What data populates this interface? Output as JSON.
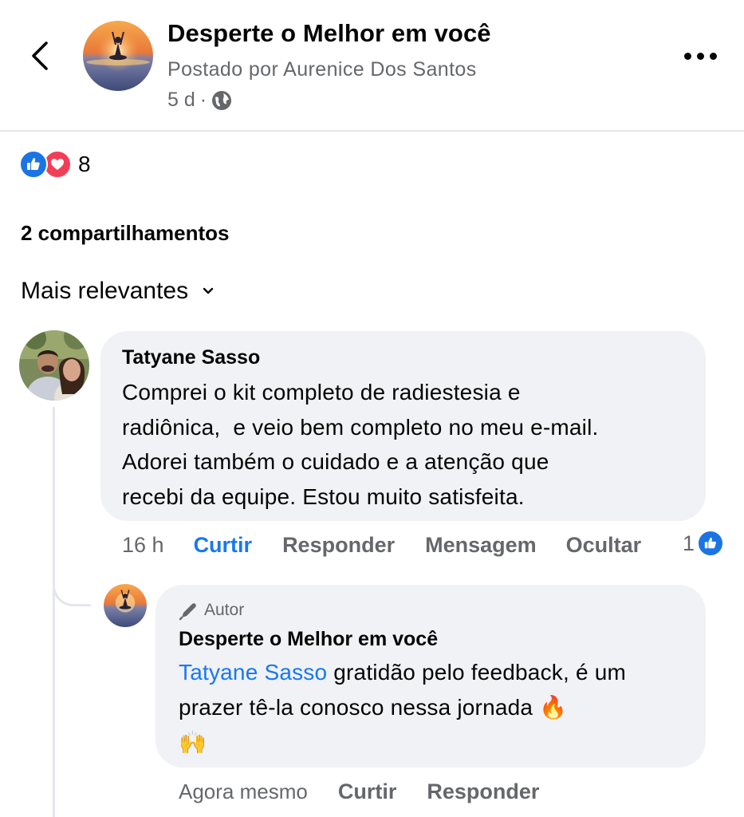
{
  "header": {
    "page_name": "Desperte o Melhor em você",
    "posted_by": "Postado por Aurenice Dos Santos",
    "time": "5 d",
    "separator": "·",
    "privacy_icon": "globe-icon"
  },
  "reactions": {
    "count": "8",
    "icons": [
      "like-icon",
      "love-icon"
    ]
  },
  "shares": "2 compartilhamentos",
  "sort": {
    "label": "Mais relevantes",
    "icon": "chevron-down-icon"
  },
  "comment": {
    "author": "Tatyane Sasso",
    "text": "Comprei o kit completo de radiestesia e\nradiônica,  e veio bem completo no meu e-mail.\nAdorei também o cuidado e a atenção que\nrecebi da equipe. Estou muito satisfeita.",
    "time": "16 h",
    "like": "Curtir",
    "reply": "Responder",
    "message": "Mensagem",
    "hide": "Ocultar",
    "like_count": "1"
  },
  "reply": {
    "badge": "Autor",
    "author": "Desperte o Melhor em você",
    "mention": "Tatyane Sasso",
    "text": " gratidão pelo feedback, é um prazer tê-la conosco nessa jornada ",
    "emoji_fire": "🔥",
    "emoji_hands": "🙌",
    "time": "Agora mesmo",
    "like": "Curtir",
    "reply": "Responder"
  },
  "colors": {
    "accent": "#1877f2",
    "bubble": "#f0f2f5",
    "secondary_text": "#65676b",
    "love": "#f33e58"
  }
}
